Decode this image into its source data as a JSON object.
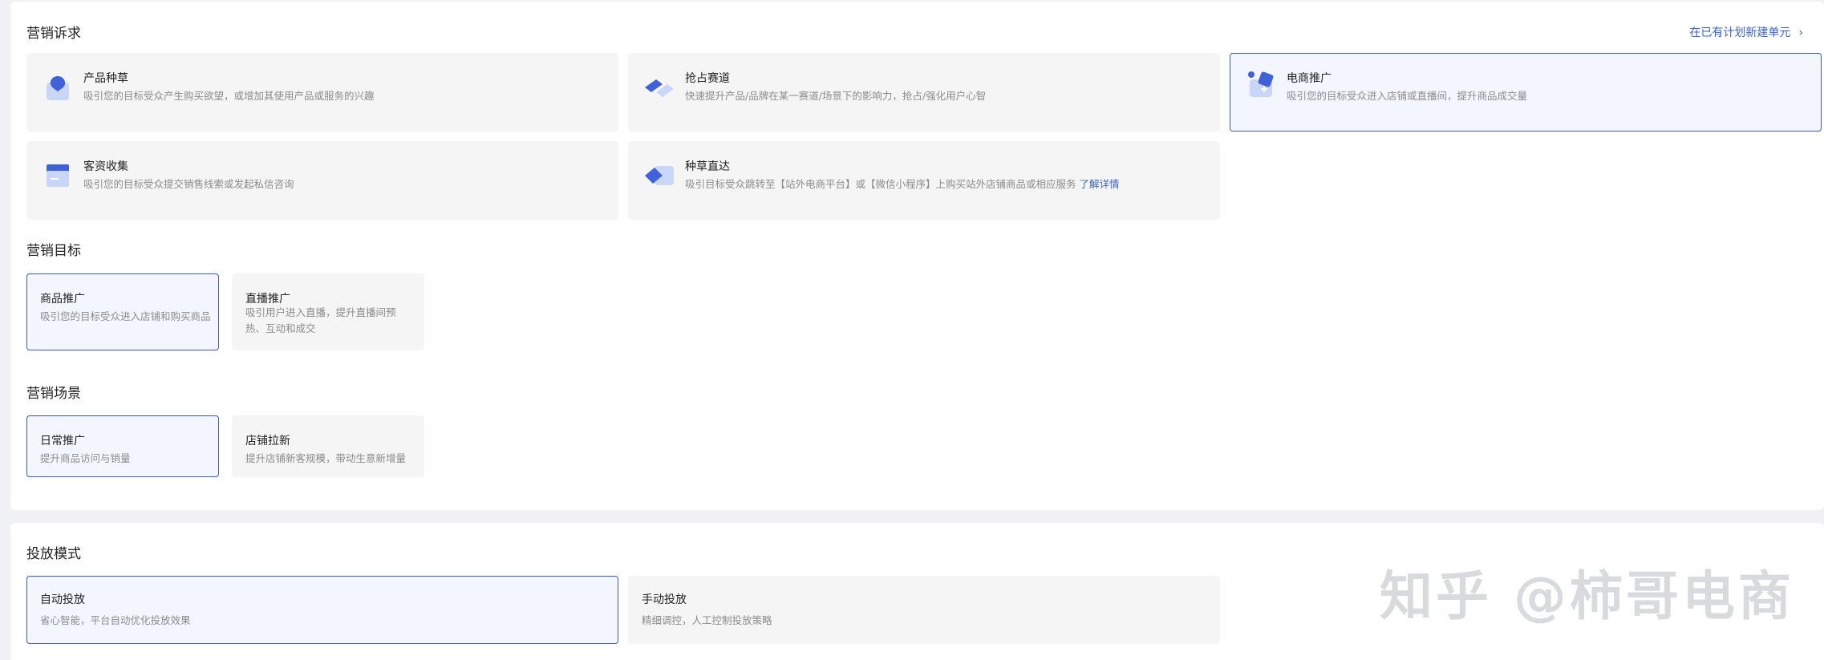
{
  "appeal": {
    "title": "营销诉求",
    "new_unit_link": "在已有计划新建单元",
    "cards": [
      {
        "title": "产品种草",
        "desc": "吸引您的目标受众产生购买欲望，或增加其使用产品或服务的兴趣"
      },
      {
        "title": "抢占赛道",
        "desc": "快速提升产品/品牌在某一赛道/场景下的影响力，抢占/强化用户心智"
      },
      {
        "title": "电商推广",
        "desc": "吸引您的目标受众进入店铺或直播间，提升商品成交量"
      },
      {
        "title": "客资收集",
        "desc": "吸引您的目标受众提交销售线索或发起私信咨询"
      },
      {
        "title": "种草直达",
        "desc": "吸引目标受众跳转至【站外电商平台】或【微信小程序】上购买站外店铺商品或相应服务",
        "link": "了解详情"
      }
    ]
  },
  "goal": {
    "title": "营销目标",
    "cards": [
      {
        "title": "商品推广",
        "desc": "吸引您的目标受众进入店铺和购买商品"
      },
      {
        "title": "直播推广",
        "desc": "吸引用户进入直播，提升直播间预热、互动和成交"
      }
    ]
  },
  "scene": {
    "title": "营销场景",
    "cards": [
      {
        "title": "日常推广",
        "desc": "提升商品访问与销量"
      },
      {
        "title": "店铺拉新",
        "desc": "提升店铺新客规模，带动生意新增量"
      }
    ]
  },
  "mode": {
    "title": "投放模式",
    "cards": [
      {
        "title": "自动投放",
        "desc": "省心智能，平台自动优化投放效果"
      },
      {
        "title": "手动投放",
        "desc": "精细调控，人工控制投放策略"
      }
    ]
  },
  "watermark": "知乎 @柿哥电商",
  "colors": {
    "accent": "#3b5bbd",
    "link": "#3b64c8",
    "icon_blue": "#3f62d6"
  }
}
